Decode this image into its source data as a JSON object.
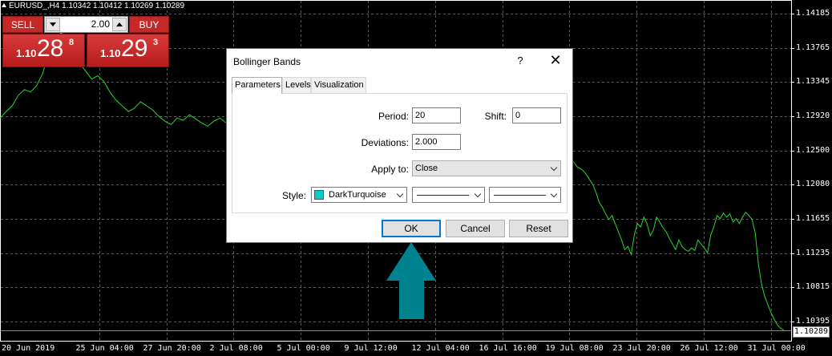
{
  "chart": {
    "symbol_label": "EURUSD_,H4  1.10342 1.10412 1.10269 1.10289",
    "current_price": "1.10289",
    "line_color": "#2bd62b",
    "y_ticks": [
      {
        "label": "1.14185",
        "value": 1.14185
      },
      {
        "label": "1.13765",
        "value": 1.13765
      },
      {
        "label": "1.13345",
        "value": 1.13345
      },
      {
        "label": "1.12920",
        "value": 1.1292
      },
      {
        "label": "1.12500",
        "value": 1.125
      },
      {
        "label": "1.12080",
        "value": 1.1208
      },
      {
        "label": "1.11655",
        "value": 1.11655
      },
      {
        "label": "1.11235",
        "value": 1.11235
      },
      {
        "label": "1.10815",
        "value": 1.10815
      },
      {
        "label": "1.10395",
        "value": 1.10395
      }
    ],
    "x_ticks": [
      "20 Jun 2019",
      "25 Jun 04:00",
      "27 Jun 20:00",
      "2 Jul 08:00",
      "5 Jul 00:00",
      "9 Jul 12:00",
      "12 Jul 04:00",
      "16 Jul 16:00",
      "19 Jul 08:00",
      "23 Jul 20:00",
      "26 Jul 12:00",
      "31 Jul 00:00"
    ],
    "price_series": [
      1.129,
      1.1298,
      1.1305,
      1.1318,
      1.1325,
      1.1322,
      1.133,
      1.1345,
      1.1372,
      1.1385,
      1.1395,
      1.1388,
      1.1372,
      1.1358,
      1.1348,
      1.1338,
      1.1342,
      1.1335,
      1.1322,
      1.1312,
      1.1305,
      1.1298,
      1.1302,
      1.131,
      1.1305,
      1.13,
      1.1292,
      1.1286,
      1.1282,
      1.129,
      1.1287,
      1.1294,
      1.1289,
      1.1284,
      1.128,
      1.1286,
      1.129,
      1.1284,
      1.1262,
      1.1255,
      1.1248,
      1.124,
      1.1236,
      1.123,
      1.1228,
      1.1225,
      1.122,
      1.1214,
      1.1208,
      1.1198,
      1.1186,
      1.118,
      1.1172,
      1.1165,
      1.117,
      1.116,
      1.115,
      1.114,
      1.1128,
      1.1132,
      1.1122,
      1.1146,
      1.116,
      1.1156,
      1.1168,
      1.116,
      1.1145,
      1.1152,
      1.1168,
      1.1162,
      1.1155,
      1.115,
      1.1142,
      1.1135,
      1.1128,
      1.114,
      1.1132,
      1.1128,
      1.1126,
      1.113,
      1.1127,
      1.114,
      1.1135,
      1.113,
      1.1124,
      1.1146,
      1.1156,
      1.117,
      1.1166,
      1.1173,
      1.1168,
      1.1172,
      1.1162,
      1.1166,
      1.116,
      1.1168,
      1.1174,
      1.117,
      1.1165,
      1.1148,
      1.111,
      1.1085,
      1.107,
      1.106,
      1.105,
      1.1042,
      1.1035,
      1.1031,
      1.1029
    ]
  },
  "trade_panel": {
    "sell_label": "SELL",
    "buy_label": "BUY",
    "lot": "2.00",
    "sell_prefix": "1.10",
    "sell_big": "28",
    "sell_sup": "8",
    "buy_prefix": "1.10",
    "buy_big": "29",
    "buy_sup": "3"
  },
  "dialog": {
    "title": "Bollinger Bands",
    "help": "?",
    "close": "✕",
    "tabs": [
      "Parameters",
      "Levels",
      "Visualization"
    ],
    "period_label": "Period:",
    "period_value": "20",
    "shift_label": "Shift:",
    "shift_value": "0",
    "deviations_label": "Deviations:",
    "deviations_value": "2.000",
    "apply_label": "Apply to:",
    "apply_value": "Close",
    "style_label": "Style:",
    "style_color_name": "DarkTurquoise",
    "style_color": "#00ced1",
    "ok": "OK",
    "cancel": "Cancel",
    "reset": "Reset"
  },
  "annotation": {
    "arrow_color": "#00838f"
  }
}
